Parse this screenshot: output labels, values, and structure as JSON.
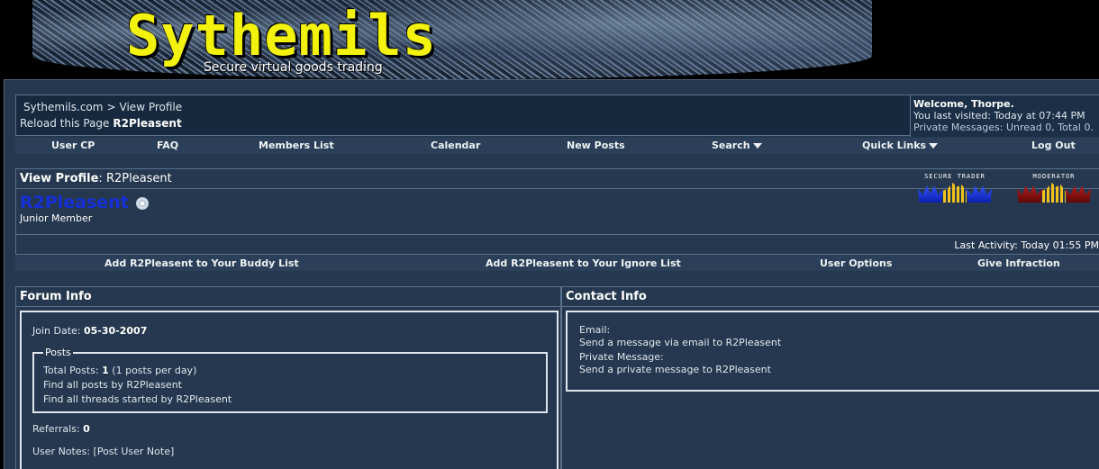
{
  "header": {
    "logo": "Sythemils",
    "tagline": "Secure virtual goods trading"
  },
  "navbox": {
    "breadcrumb_site": "Sythemils.com",
    "breadcrumb_sep": ">",
    "breadcrumb_page": "View Profile",
    "reload_label": "Reload this Page",
    "reload_user": "R2Pleasent",
    "welcome": "Welcome, Thorpe.",
    "last_visited": "You last visited: Today at 07:44 PM",
    "private_messages": "Private Messages: Unread 0, Total 0."
  },
  "menu": {
    "user_cp": "User CP",
    "faq": "FAQ",
    "members_list": "Members List",
    "calendar": "Calendar",
    "new_posts": "New Posts",
    "search": "Search",
    "quick_links": "Quick Links",
    "log_out": "Log Out"
  },
  "profile": {
    "header_label": "View Profile",
    "header_user": "R2Pleasent",
    "username": "R2Pleasent",
    "user_title": "Junior Member",
    "last_activity": "Last Activity: Today 01:55 PM",
    "badges": [
      {
        "label": "SECURE TRADER",
        "color": "#1a33e0"
      },
      {
        "label": "MODERATOR",
        "color": "#a01010"
      }
    ]
  },
  "actions": {
    "add_buddy": "Add R2Pleasent to Your Buddy List",
    "add_ignore": "Add R2Pleasent to Your Ignore List",
    "user_options": "User Options",
    "give_infraction": "Give Infraction"
  },
  "forum_info": {
    "title": "Forum Info",
    "join_label": "Join Date:",
    "join_date": "05-30-2007",
    "posts_legend": "Posts",
    "total_posts_label": "Total Posts:",
    "total_posts": "1",
    "posts_per_day": "(1 posts per day)",
    "find_posts": "Find all posts by R2Pleasent",
    "find_threads": "Find all threads started by R2Pleasent",
    "referrals_label": "Referrals:",
    "referrals": "0",
    "user_notes_label": "User Notes:",
    "post_user_note": "[Post User Note]"
  },
  "contact_info": {
    "title": "Contact Info",
    "email_label": "Email:",
    "email_link": "Send a message via email to R2Pleasent",
    "pm_label": "Private Message:",
    "pm_link": "Send a private message to R2Pleasent"
  }
}
